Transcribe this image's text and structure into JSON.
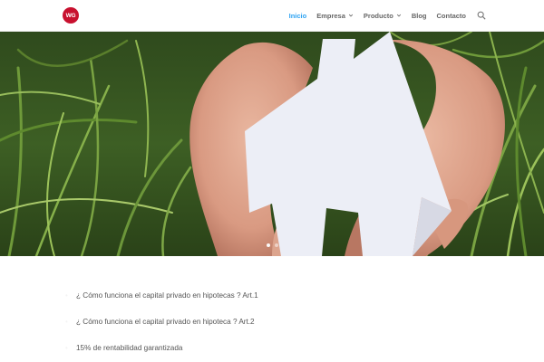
{
  "colors": {
    "accent": "#2ea3f2",
    "logo_bg": "#c8102e",
    "nav_text": "#666666",
    "body_text": "#555555"
  },
  "header": {
    "logo_text": "WG",
    "nav": [
      {
        "label": "Inicio",
        "active": true,
        "has_dropdown": false
      },
      {
        "label": "Empresa",
        "active": false,
        "has_dropdown": true
      },
      {
        "label": "Producto",
        "active": false,
        "has_dropdown": true
      },
      {
        "label": "Blog",
        "active": false,
        "has_dropdown": false
      },
      {
        "label": "Contacto",
        "active": false,
        "has_dropdown": false
      }
    ],
    "search_icon": "search-icon"
  },
  "hero": {
    "slide_count": 2,
    "active_slide": 1
  },
  "articles": [
    {
      "label": "¿ Cómo funciona el capital privado en hipotecas ? Art.1"
    },
    {
      "label": "¿ Cómo funciona el capital privado en hipoteca ? Art.2"
    },
    {
      "label": "15% de rentabilidad garantizada"
    }
  ]
}
